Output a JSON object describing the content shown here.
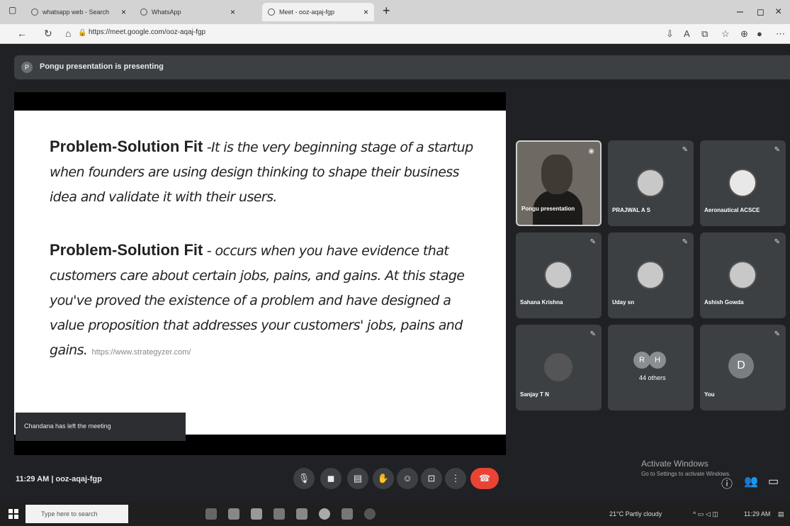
{
  "browser": {
    "tabs": [
      {
        "title": "whatsapp web - Search"
      },
      {
        "title": "WhatsApp"
      },
      {
        "title": "Meet - ooz-aqaj-fgp"
      }
    ],
    "url": "https://meet.google.com/ooz-aqaj-fgp"
  },
  "meet": {
    "presenting_initial": "P",
    "presenting_text": "Pongu presentation is presenting",
    "slide": {
      "p1_heading": "Problem-Solution Fit",
      "p1_body": " -It is the very beginning stage of a startup when founders are using design thinking to shape their business idea and validate it with their users.",
      "p2_heading": "Problem-Solution Fit",
      "p2_body": " - occurs when you have evidence that customers care about certain jobs, pains, and gains. At this stage you've proved the existence of a problem and have designed a value proposition that addresses your customers' jobs, pains and gains.",
      "link": "https://www.strategyzer.com/"
    },
    "toast": "Chandana has left the meeting",
    "participants": [
      {
        "name": "Pongu presentation"
      },
      {
        "name": "PRAJWAL A S"
      },
      {
        "name": "Aeronautical ACSCE"
      },
      {
        "name": "Sahana Krishna"
      },
      {
        "name": "Uday sn"
      },
      {
        "name": "Ashish Gowda"
      },
      {
        "name": "Sanjay T N"
      },
      {
        "name": "44 others",
        "initials": [
          "R",
          "H"
        ]
      },
      {
        "name": "You",
        "initial": "D"
      }
    ],
    "meeting_info": "11:29 AM  |  ooz-aqaj-fgp",
    "activate_title": "Activate Windows",
    "activate_sub": "Go to Settings to activate Windows."
  },
  "taskbar": {
    "search_placeholder": "Type here to search",
    "weather": "21°C  Partly cloudy",
    "time": "11:29 AM"
  }
}
